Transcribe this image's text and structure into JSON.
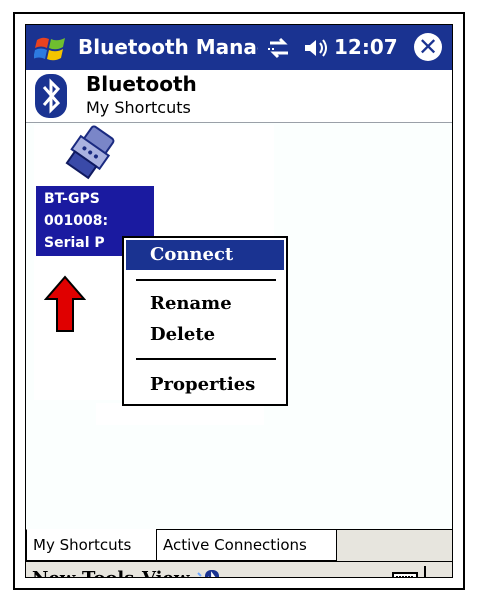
{
  "titlebar": {
    "app_title": "Bluetooth Manager",
    "clock": "12:07",
    "close_glyph": "✕",
    "icons": [
      "windows-start-icon",
      "connectivity-icon",
      "volume-icon",
      "close-icon"
    ]
  },
  "header": {
    "title": "Bluetooth",
    "subtitle": "My Shortcuts",
    "icon": "bluetooth-icon"
  },
  "shortcut": {
    "lines": [
      "BT-GPS",
      "001008:",
      "Serial P"
    ],
    "icon": "serial-port-icon"
  },
  "context_menu": {
    "items": [
      {
        "label": "Connect",
        "selected": true
      },
      {
        "label": "Rename",
        "selected": false
      },
      {
        "label": "Delete",
        "selected": false
      },
      {
        "label": "Properties",
        "selected": false
      }
    ]
  },
  "tabs": [
    {
      "label": "My Shortcuts",
      "active": true
    },
    {
      "label": "Active Connections",
      "active": false
    }
  ],
  "menubar": {
    "new": "New",
    "tools": "Tools",
    "view": "View",
    "icons": [
      "bluetooth-icon",
      "keyboard-icon",
      "up-arrow-icon"
    ]
  },
  "colors": {
    "titlebar": "#1a3391",
    "selection": "#1a1aa0",
    "bar_bg": "#e7e5de",
    "arrow": "#e00000"
  }
}
